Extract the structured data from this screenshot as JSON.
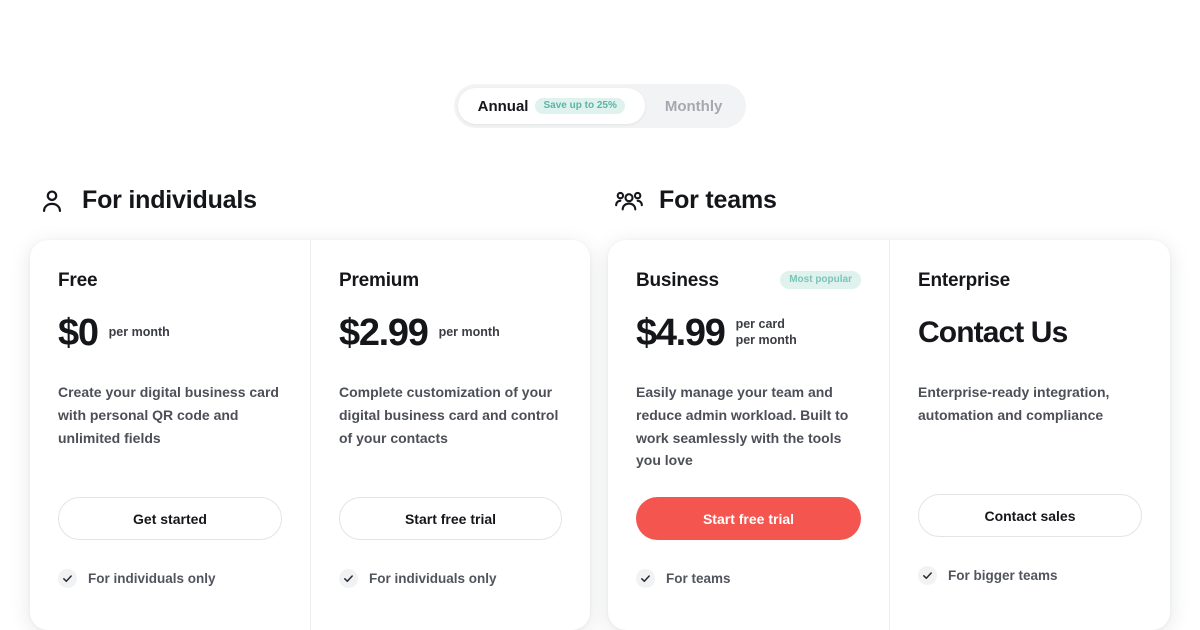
{
  "billing_toggle": {
    "annual_label": "Annual",
    "save_badge": "Save up to 25%",
    "monthly_label": "Monthly",
    "selected": "Annual"
  },
  "sections": [
    {
      "id": "individuals",
      "title": "For individuals",
      "icon": "person-icon"
    },
    {
      "id": "teams",
      "title": "For teams",
      "icon": "people-group-icon"
    }
  ],
  "colors": {
    "primary_cta": "#F4554F",
    "badge_bg": "#DFF2EE",
    "badge_text": "#5BB5A5",
    "text": "#15161A"
  },
  "plans": [
    {
      "name": "Free",
      "price": "$0",
      "unit": "per month",
      "badge": "",
      "description": "Create your digital business card with personal QR code and unlimited fields",
      "cta": "Get started",
      "cta_style": "outline",
      "feature": "For individuals only"
    },
    {
      "name": "Premium",
      "price": "$2.99",
      "unit": "per month",
      "badge": "",
      "description": "Complete customization of your digital business card and control of your contacts",
      "cta": "Start free trial",
      "cta_style": "outline",
      "feature": "For individuals only"
    },
    {
      "name": "Business",
      "price": "$4.99",
      "unit": "per card\nper month",
      "badge": "Most popular",
      "description": "Easily manage your team and reduce admin workload. Built to work seamlessly with the tools you love",
      "cta": "Start free trial",
      "cta_style": "primary",
      "feature": "For teams"
    },
    {
      "name": "Enterprise",
      "price": "Contact Us",
      "unit": "",
      "badge": "",
      "description": "Enterprise-ready integration, automation and compliance",
      "cta": "Contact sales",
      "cta_style": "outline",
      "feature": "For bigger teams"
    }
  ]
}
